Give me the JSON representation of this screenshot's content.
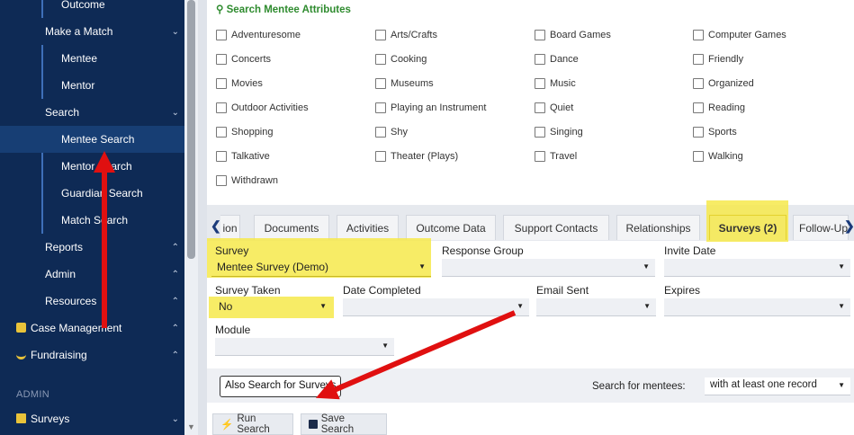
{
  "sidebar": {
    "items": [
      {
        "label": "Outcome",
        "chevron": ""
      },
      {
        "label": "Make a Match",
        "chevron": "⌄"
      },
      {
        "label": "Mentee",
        "chevron": ""
      },
      {
        "label": "Mentor",
        "chevron": ""
      },
      {
        "label": "Search",
        "chevron": "⌄"
      },
      {
        "label": "Mentee Search",
        "chevron": ""
      },
      {
        "label": "Mentor Search",
        "chevron": ""
      },
      {
        "label": "Guardian Search",
        "chevron": ""
      },
      {
        "label": "Match Search",
        "chevron": ""
      },
      {
        "label": "Reports",
        "chevron": "⌃"
      },
      {
        "label": "Admin",
        "chevron": "⌃"
      },
      {
        "label": "Resources",
        "chevron": "⌃"
      },
      {
        "label": "Case Management",
        "chevron": "⌃"
      },
      {
        "label": "Fundraising",
        "chevron": "⌃"
      },
      {
        "label": "Surveys",
        "chevron": "⌄"
      }
    ],
    "admin_heading": "ADMIN"
  },
  "attributes": {
    "title": "Search Mentee Attributes",
    "items": [
      "Adventuresome",
      "Arts/Crafts",
      "Board Games",
      "Computer Games",
      "Concerts",
      "Cooking",
      "Dance",
      "Friendly",
      "Movies",
      "Museums",
      "Music",
      "Organized",
      "Outdoor Activities",
      "Playing an Instrument",
      "Quiet",
      "Reading",
      "Shopping",
      "Shy",
      "Singing",
      "Sports",
      "Talkative",
      "Theater (Plays)",
      "Travel",
      "Walking",
      "Withdrawn"
    ]
  },
  "tabs": [
    "ion",
    "Documents",
    "Activities",
    "Outcome Data",
    "Support Contacts",
    "Relationships",
    "Surveys (2)",
    "Follow-Up"
  ],
  "form": {
    "survey_label": "Survey",
    "survey_value": "Mentee Survey (Demo)",
    "response_group_label": "Response Group",
    "invite_date_label": "Invite Date",
    "survey_taken_label": "Survey Taken",
    "survey_taken_value": "No",
    "date_completed_label": "Date Completed",
    "email_sent_label": "Email Sent",
    "expires_label": "Expires",
    "module_label": "Module"
  },
  "footer": {
    "also_search": "Also Search for Surveys",
    "search_for_mentees_label": "Search for mentees:",
    "search_for_mentees_value": "with at least one record",
    "run_search": "Run Search",
    "save_search": "Save Search"
  },
  "colors": {
    "sidebar_bg": "#0e2a55",
    "accent_green": "#2e8b2e",
    "highlight": "#f6e94b",
    "annotation_red": "#e01010"
  }
}
